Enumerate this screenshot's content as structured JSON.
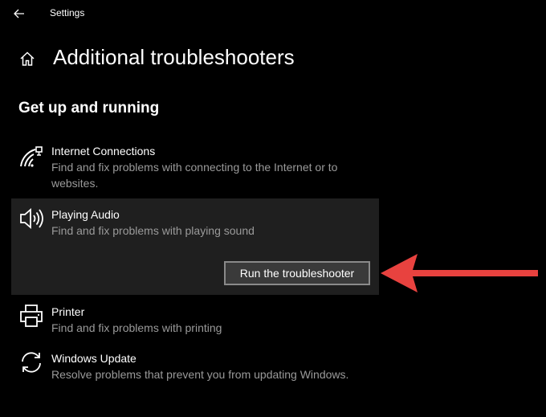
{
  "window": {
    "title": "Settings"
  },
  "page": {
    "title": "Additional troubleshooters",
    "section_title": "Get up and running"
  },
  "troubleshooters": [
    {
      "name": "Internet Connections",
      "description": "Find and fix problems with connecting to the Internet or to websites.",
      "icon": "wifi-signal-icon"
    },
    {
      "name": "Playing Audio",
      "description": "Find and fix problems with playing sound",
      "icon": "speaker-icon",
      "selected": true,
      "action_label": "Run the troubleshooter"
    },
    {
      "name": "Printer",
      "description": "Find and fix problems with printing",
      "icon": "printer-icon"
    },
    {
      "name": "Windows Update",
      "description": "Resolve problems that prevent you from updating Windows.",
      "icon": "refresh-icon"
    }
  ],
  "colors": {
    "background": "#000000",
    "selected_item_background": "#1f1f1f",
    "description_text": "#9a9a9a",
    "annotation_arrow": "#e8423f"
  }
}
